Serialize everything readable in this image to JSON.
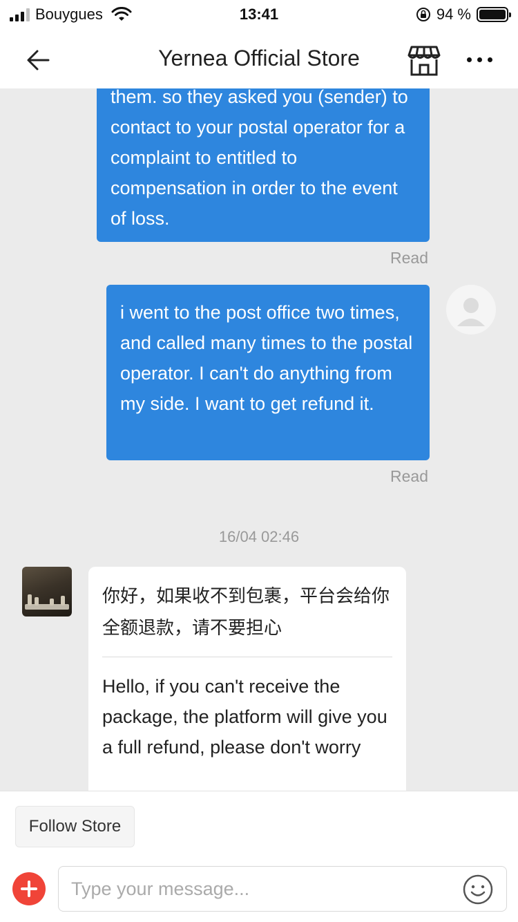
{
  "status_bar": {
    "carrier": "Bouygues",
    "time": "13:41",
    "battery": "94 %"
  },
  "header": {
    "title": "Yernea Official Store"
  },
  "messages": [
    {
      "side": "right",
      "text": "them. so they asked you (sender) to contact to your postal operator for a complaint to entitled to compensation in order to the event of loss.",
      "status": "Read"
    },
    {
      "side": "right",
      "text": "i went to the post office two times, and called many times to the postal operator. I can't do anything from my side. I want to get refund it.",
      "status": "Read"
    }
  ],
  "timestamp": "16/04 02:46",
  "store_message": {
    "original": "你好，如果收不到包裹，平台会给你全额退款，请不要担心",
    "translation": "Hello, if you can't receive the package, the platform will give you a full refund, please don't worry"
  },
  "bottom": {
    "follow_label": "Follow Store",
    "input_placeholder": "Type your message..."
  },
  "colors": {
    "bubble_blue": "#2e86de",
    "plus_red": "#f04438",
    "background": "#ebebeb"
  }
}
